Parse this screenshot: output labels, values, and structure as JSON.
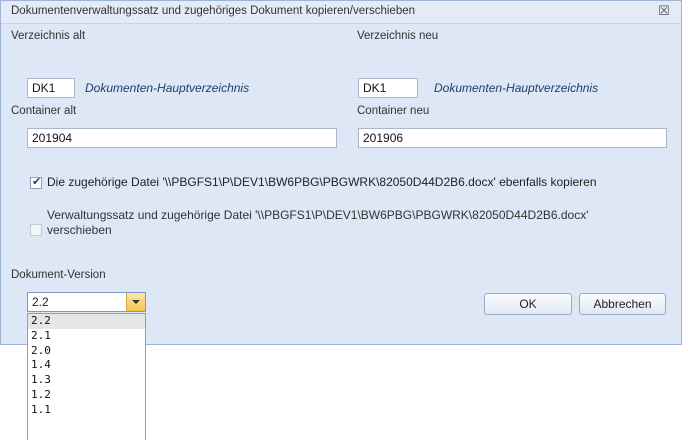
{
  "dialog": {
    "title": "Dokumentenverwaltungssatz und zugehöriges Dokument kopieren/verschieben",
    "close_glyph": "☒"
  },
  "verzeichnis_alt": {
    "label": "Verzeichnis alt",
    "value": "DK1",
    "description": "Dokumenten-Hauptverzeichnis"
  },
  "verzeichnis_neu": {
    "label": "Verzeichnis neu",
    "value": "DK1",
    "description": "Dokumenten-Hauptverzeichnis"
  },
  "container_alt": {
    "label": "Container alt",
    "value": "201904"
  },
  "container_neu": {
    "label": "Container neu",
    "value": "201906"
  },
  "options": {
    "copy": {
      "checked": true,
      "enabled": true,
      "label": "Die zugehörige Datei '\\\\PBGFS1\\P\\DEV1\\BW6PBG\\PBGWRK\\82050D44D2B6.docx' ebenfalls kopieren"
    },
    "move": {
      "checked": false,
      "enabled": false,
      "label_line1": "Verwaltungssatz und zugehörige Datei '\\\\PBGFS1\\P\\DEV1\\BW6PBG\\PBGWRK\\82050D44D2B6.docx'",
      "label_line2": "verschieben"
    }
  },
  "version": {
    "label": "Dokument-Version",
    "selected": "2.2",
    "options": [
      "2.2",
      "2.1",
      "2.0",
      "1.4",
      "1.3",
      "1.2",
      "1.1"
    ]
  },
  "buttons": {
    "ok": "OK",
    "cancel": "Abbrechen"
  },
  "icons": {
    "close": "close-icon",
    "check": "check-icon",
    "dropdown": "chevron-down-icon"
  }
}
